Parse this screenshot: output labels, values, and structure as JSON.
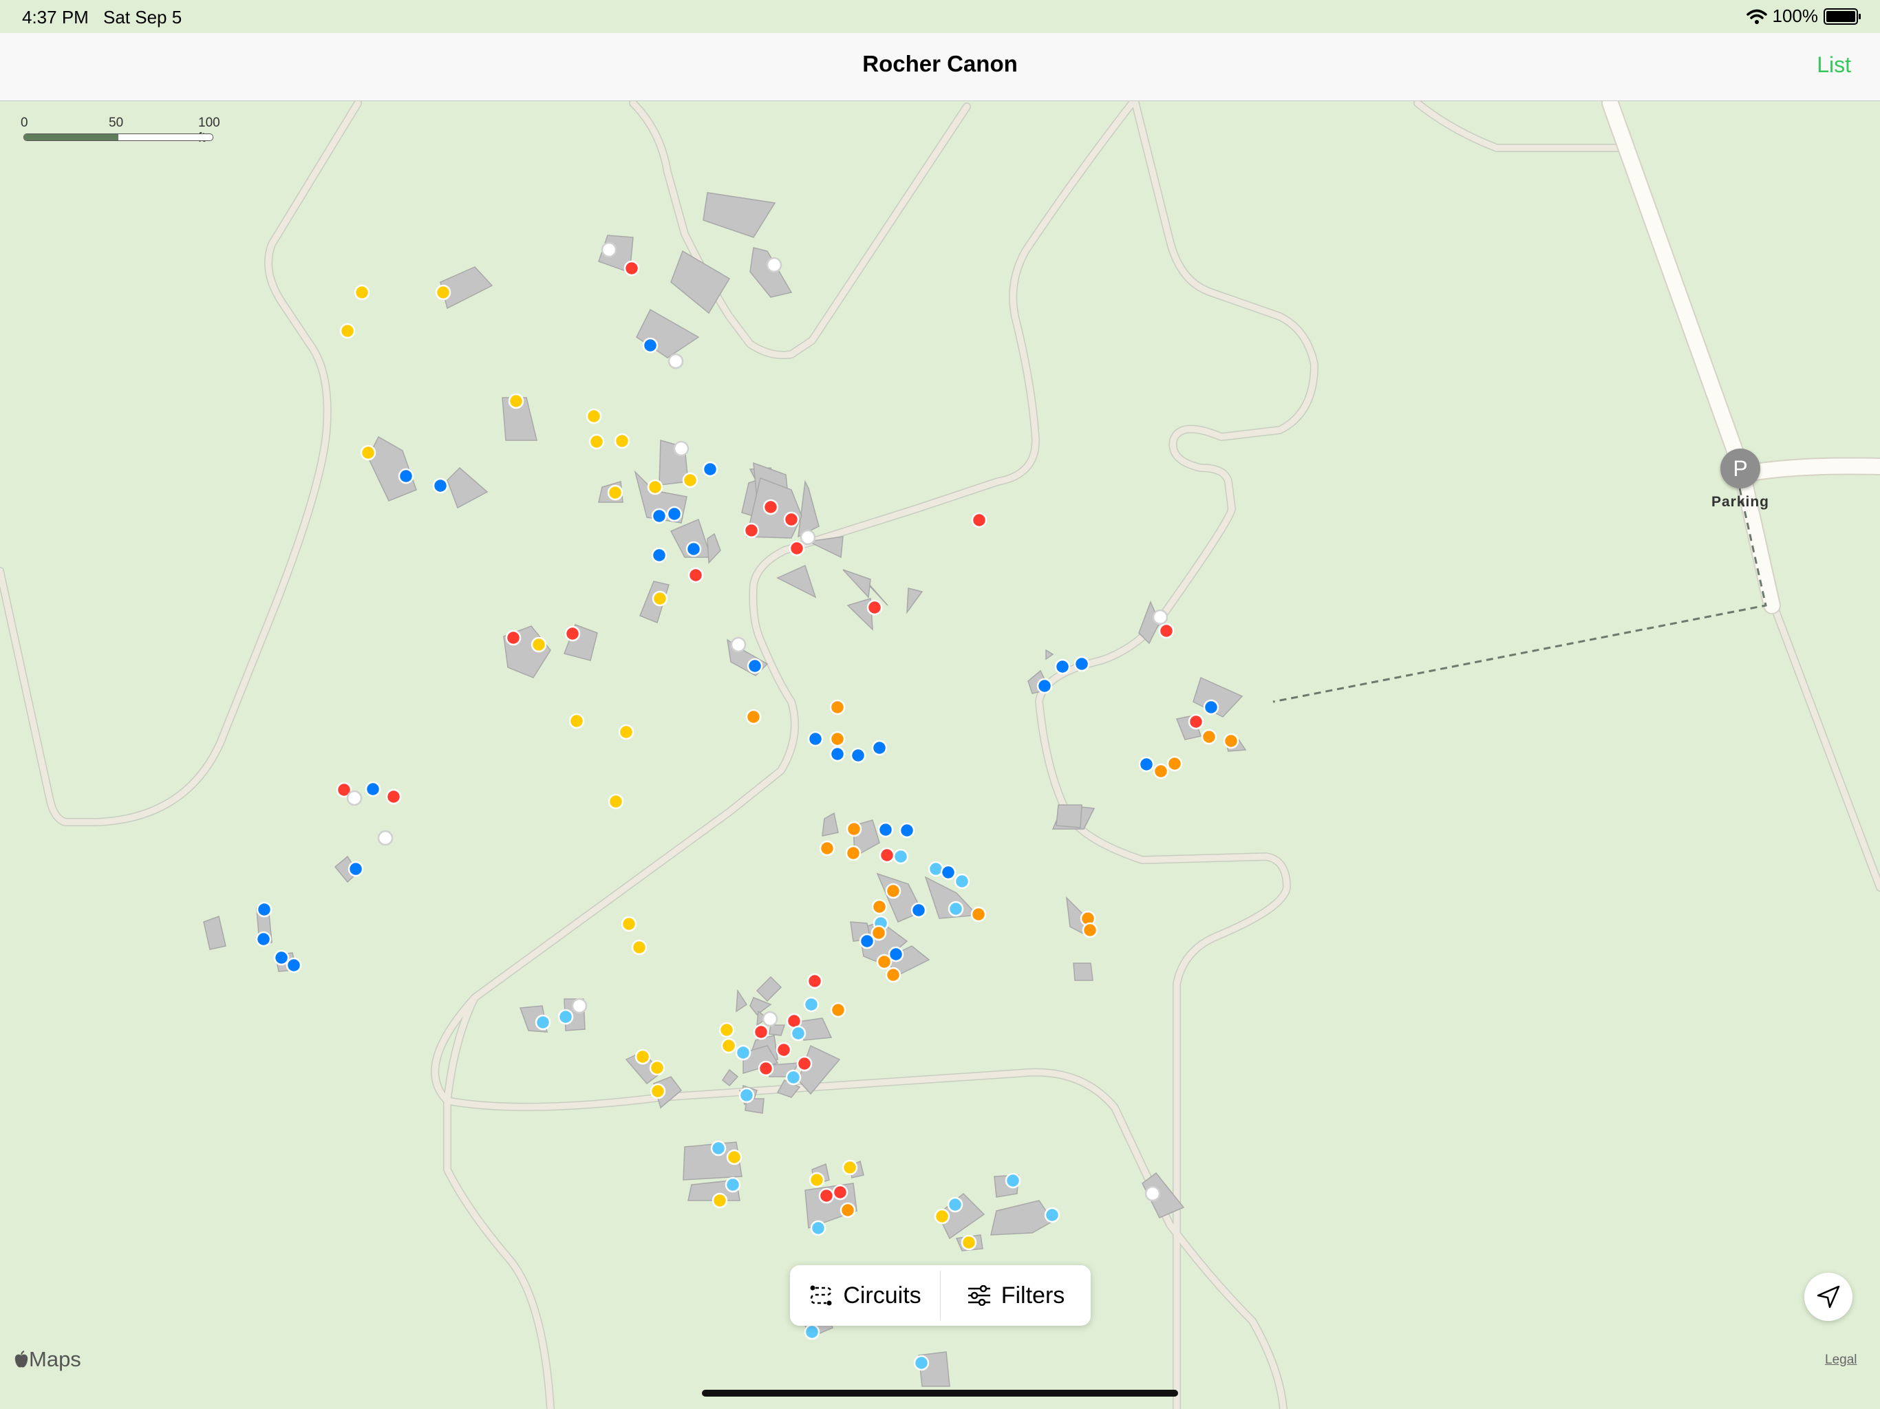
{
  "status": {
    "time": "4:37 PM",
    "date": "Sat Sep 5",
    "battery": "100%"
  },
  "nav": {
    "title": "Rocher Canon",
    "list_label": "List"
  },
  "scale": {
    "labels": [
      "0",
      "50",
      "100 ft"
    ]
  },
  "parking": {
    "symbol": "P",
    "label": "Parking"
  },
  "toolbar": {
    "circuits_label": "Circuits",
    "filters_label": "Filters"
  },
  "footer": {
    "maps_label": "Maps",
    "legal_label": "Legal"
  },
  "colors": {
    "map_bg": "#dfeed4",
    "trail": "#ede9df",
    "road": "#fdfbf5",
    "boulder": "#c4c4c4",
    "red": "#ff3b30",
    "yellow": "#ffcc00",
    "blue": "#007aff",
    "light_blue": "#5ac8fa",
    "orange": "#ff9500",
    "white": "#ffffff",
    "accent": "#34c759"
  },
  "icons": [
    "wifi-icon",
    "battery-icon",
    "parking-icon",
    "circuits-icon",
    "filters-icon",
    "location-arrow-icon",
    "apple-icon"
  ]
}
